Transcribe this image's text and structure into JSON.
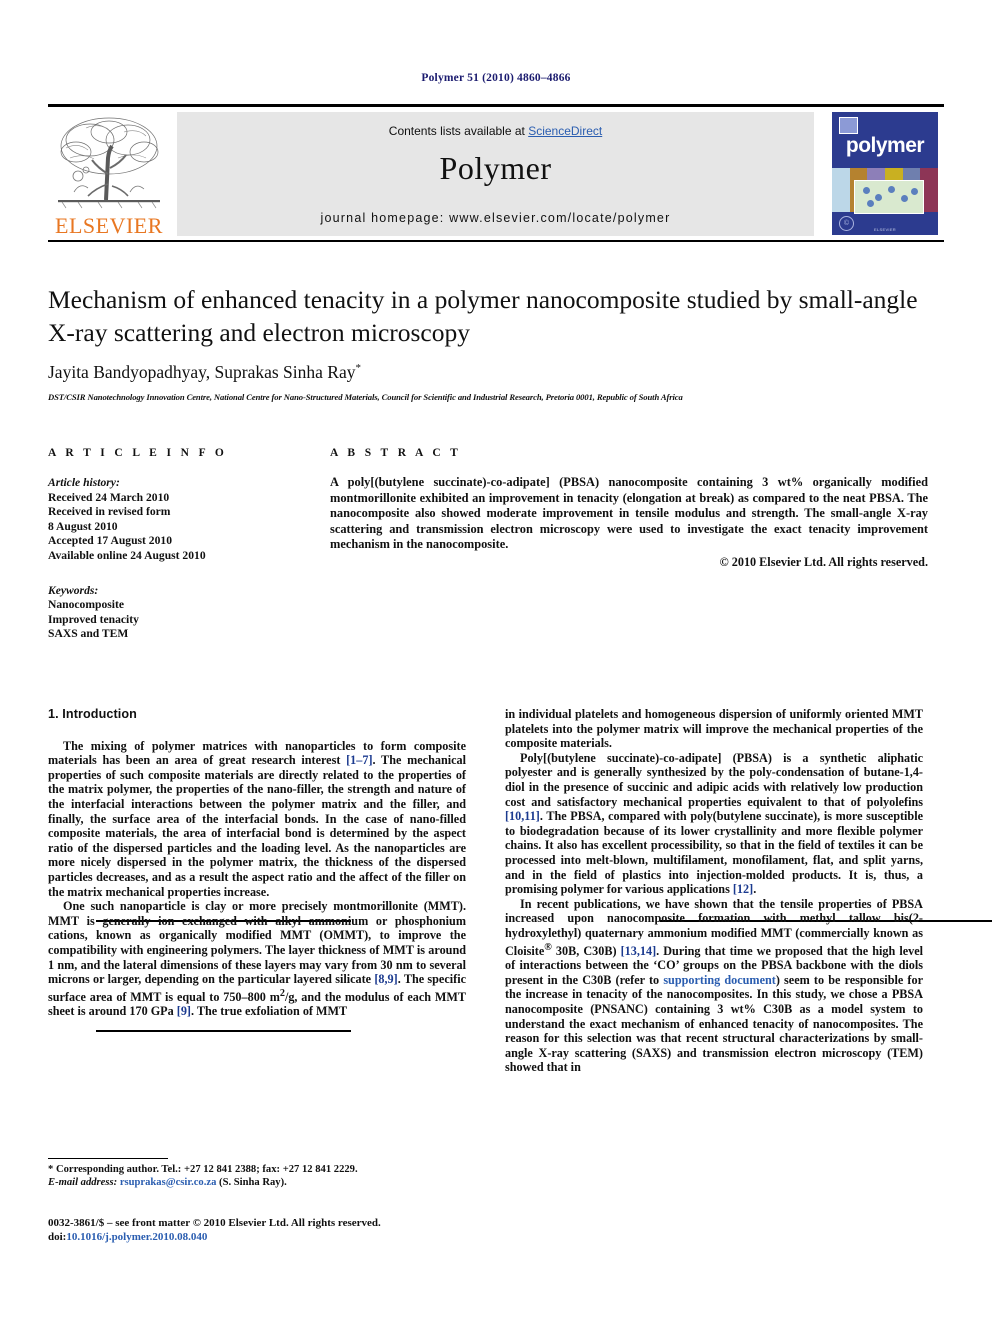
{
  "running_head": "Polymer 51 (2010) 4860–4866",
  "header": {
    "publisher_name": "ELSEVIER",
    "contents_text": "Contents lists available at ",
    "contents_link": "ScienceDirect",
    "journal_title": "Polymer",
    "homepage": "journal homepage: www.elsevier.com/locate/polymer",
    "cover_word": "polymer",
    "cover_footer": "ELSEVIER"
  },
  "article": {
    "title": "Mechanism of enhanced tenacity in a polymer nanocomposite studied by small-angle X-ray scattering and electron microscopy",
    "authors": "Jayita Bandyopadhyay, Suprakas Sinha Ray",
    "author_marker": "*",
    "affiliation": "DST/CSIR Nanotechnology Innovation Centre, National Centre for Nano-Structured Materials, Council for Scientific and Industrial Research, Pretoria 0001, Republic of South Africa"
  },
  "info": {
    "heading": "A R T I C L E   I N F O",
    "history_label": "Article history:",
    "history": [
      "Received 24 March 2010",
      "Received in revised form",
      "8 August 2010",
      "Accepted 17 August 2010",
      "Available online 24 August 2010"
    ],
    "keywords_label": "Keywords:",
    "keywords": [
      "Nanocomposite",
      "Improved tenacity",
      "SAXS and TEM"
    ]
  },
  "abstract": {
    "heading": "A B S T R A C T",
    "text": "A poly[(butylene succinate)-co-adipate] (PBSA) nanocomposite containing 3 wt% organically modified montmorillonite exhibited an improvement in tenacity (elongation at break) as compared to the neat PBSA. The nanocomposite also showed moderate improvement in tensile modulus and strength. The small-angle X-ray scattering and transmission electron microscopy were used to investigate the exact tenacity improvement mechanism in the nanocomposite.",
    "rights": "© 2010 Elsevier Ltd. All rights reserved."
  },
  "body": {
    "section_number_title": "1. Introduction",
    "left_p1_a": "The mixing of polymer matrices with nanoparticles to form composite materials has been an area of great research interest ",
    "left_p1_ref": "[1–7]",
    "left_p1_b": ". The mechanical properties of such composite materials are directly related to the properties of the matrix polymer, the properties of the nano-filler, the strength and nature of the interfacial interactions between the polymer matrix and the filler, and finally, the surface area of the interfacial bonds. In the case of nano-filled composite materials, the area of interfacial bond is determined by the aspect ratio of the dispersed particles and the loading level. As the nanoparticles are more nicely dispersed in the polymer matrix, the thickness of the dispersed particles decreases, and as a result the aspect ratio and the affect of the filler on the matrix mechanical properties increase.",
    "left_p2_a": "One such nanoparticle is clay or more precisely montmorillonite (MMT). MMT is generally ion exchanged with alkyl ammonium or phosphonium cations, known as organically modified MMT (OMMT), to improve the compatibility with engineering polymers. The layer thickness of MMT is around 1 nm, and the lateral dimensions of these layers may vary from 30 nm to several microns or larger, depending on the particular layered silicate ",
    "left_p2_ref1": "[8,9]",
    "left_p2_b": ". The specific surface area of MMT is equal to 750–800 m",
    "left_p2_sup": "2",
    "left_p2_c": "/g, and the modulus of each MMT sheet is around 170 GPa ",
    "left_p2_ref2": "[9]",
    "left_p2_d": ". The true exfoliation of MMT",
    "right_p1": "in individual platelets and homogeneous dispersion of uniformly oriented MMT platelets into the polymer matrix will improve the mechanical properties of the composite materials.",
    "right_p2_a": "Poly[(butylene succinate)-co-adipate] (PBSA) is a synthetic aliphatic polyester and is generally synthesized by the poly-condensation of butane-1,4-diol in the presence of succinic and adipic acids with relatively low production cost and satisfactory mechanical properties equivalent to that of polyolefins ",
    "right_p2_ref1": "[10,11]",
    "right_p2_b": ". The PBSA, compared with poly(butylene succinate), is more susceptible to biodegradation because of its lower crystallinity and more flexible polymer chains. It also has excellent processibility, so that in the field of textiles it can be processed into melt-blown, multifilament, monofilament, flat, and split yarns, and in the field of plastics into injection-molded products. It is, thus, a promising polymer for various applications ",
    "right_p2_ref2": "[12]",
    "right_p2_c": ".",
    "right_p3_a": "In recent publications, we have shown that the tensile properties of PBSA increased upon nanocomposite formation with methyl tallow bis(2-hydroxylethyl) quaternary ammonium modified MMT (commercially known as Cloisite",
    "right_p3_sup": "®",
    "right_p3_b": " 30B, C30B) ",
    "right_p3_ref1": "[13,14]",
    "right_p3_c": ". During that time we proposed that the high level of interactions between the ‘CO’ groups on the PBSA backbone with the diols present in the C30B (refer to ",
    "right_p3_link": "supporting document",
    "right_p3_d": ") seem to be responsible for the increase in tenacity of the nanocomposites. In this study, we chose a PBSA nanocomposite (PNSANC) containing 3 wt% C30B as a model system to understand the exact mechanism of enhanced tenacity of nanocomposites. The reason for this selection was that recent structural characterizations by small-angle X-ray scattering (SAXS) and transmission electron microscopy (TEM) showed that in"
  },
  "footnotes": {
    "corresponding_marker": "*",
    "corresponding": " Corresponding author. Tel.: +27 12 841 2388; fax: +27 12 841 2229.",
    "email_label": "E-mail address:",
    "email": "rsuprakas@csir.co.za",
    "email_suffix": " (S. Sinha Ray)."
  },
  "imprint": {
    "issn_line": "0032-3861/$ – see front matter © 2010 Elsevier Ltd. All rights reserved.",
    "doi_label": "doi:",
    "doi": "10.1016/j.polymer.2010.08.040"
  },
  "colors": {
    "link_blue": "#2a5db0",
    "ref_blue": "#1b3a8f",
    "elsevier_orange": "#E87722",
    "cover_blue": "#2c3b8f",
    "band_gray": "#e6e6e6",
    "runhead_navy": "#1b1b6f"
  }
}
